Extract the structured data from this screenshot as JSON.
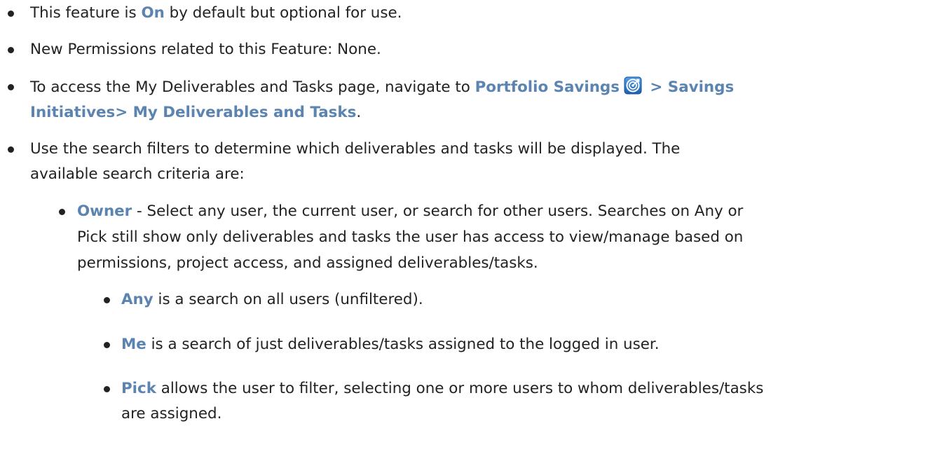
{
  "bullets": {
    "b1": {
      "pre": "This feature is ",
      "highlight": "On",
      "post": " by default but optional for use."
    },
    "b2": {
      "text": "New Permissions related to this Feature: None."
    },
    "b3": {
      "pre": "To access the My Deliverables and Tasks page, navigate to ",
      "path_1": "Portfolio Savings",
      "icon": "target-icon",
      "path_2": " > Savings",
      "path_3": "Initiatives> My Deliverables and Tasks",
      "post": "."
    },
    "b4": {
      "line_1": "Use the search filters to determine which deliverables and tasks will be displayed. The",
      "line_2": "available search criteria are:"
    }
  },
  "owner": {
    "label": "Owner",
    "line_1": " - Select any user, the current user, or search for other users. Searches on Any or",
    "line_2": "Pick still show only deliverables and tasks the user has access to view/manage based on",
    "line_3": "permissions, project access, and assigned deliverables/tasks.",
    "options": {
      "any": {
        "label": "Any",
        "text": " is a search on all users (unfiltered)."
      },
      "me": {
        "label": "Me",
        "text": " is a search of just deliverables/tasks assigned to the logged in user."
      },
      "pick": {
        "label": "Pick",
        "line_1": " allows the user to filter, selecting one or more users to whom deliverables/tasks",
        "line_2": "are assigned."
      }
    }
  },
  "colors": {
    "highlight": "#5b84b1",
    "text": "#222222"
  }
}
